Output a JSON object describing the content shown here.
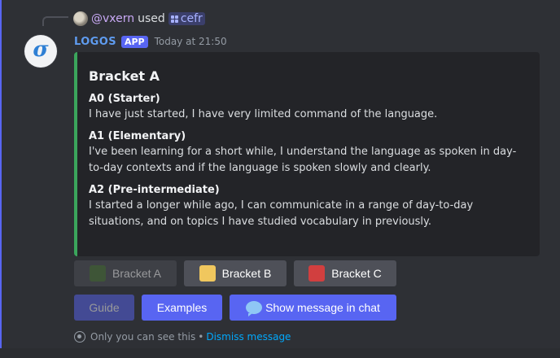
{
  "reply": {
    "username": "@vxern",
    "used_text": "used",
    "command": "cefr"
  },
  "message": {
    "bot_name": "LOGOS",
    "app_tag": "APP",
    "timestamp": "Today at 21:50",
    "avatar_glyph": "σ"
  },
  "embed": {
    "accent_color": "#3ba55c",
    "title": "Bracket A",
    "fields": [
      {
        "name": "A0 (Starter)",
        "value": "I have just started, I have very limited command of the language."
      },
      {
        "name": "A1 (Elementary)",
        "value": "I've been learning for a short while, I understand the language as spoken in day-to-day contexts and if the language is spoken slowly and clearly."
      },
      {
        "name": "A2 (Pre-intermediate)",
        "value": "I started a longer while ago, I can communicate in a range of day-to-day situations, and on topics I have studied vocabulary in previously."
      }
    ]
  },
  "buttons": {
    "bracket_a": {
      "label": "Bracket A",
      "color": "#4f7a3a",
      "disabled": true
    },
    "bracket_b": {
      "label": "Bracket B",
      "color": "#f0c75e",
      "disabled": false
    },
    "bracket_c": {
      "label": "Bracket C",
      "color": "#d13f3f",
      "disabled": false
    },
    "guide": {
      "label": "Guide",
      "disabled": true
    },
    "examples": {
      "label": "Examples"
    },
    "show_in_chat": {
      "label": "Show message in chat"
    }
  },
  "footer": {
    "only_you": "Only you can see this",
    "separator": "•",
    "dismiss": "Dismiss message"
  }
}
